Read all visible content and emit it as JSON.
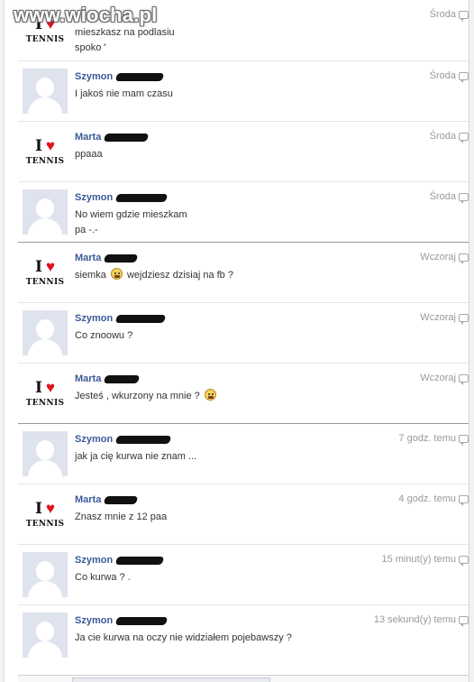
{
  "watermark": {
    "text": "www.wiocha.pl"
  },
  "messages": [
    {
      "author": "",
      "avatar": "tennis",
      "text": "mieszkasz na podlasiu\nspoko '",
      "time": "Środa",
      "scribble_width": 0
    },
    {
      "author": "Szymon",
      "avatar": "default",
      "text": "I jakoś nie mam czasu",
      "time": "Środa",
      "scribble_width": 52
    },
    {
      "author": "Marta",
      "avatar": "tennis",
      "text": "ppaaa",
      "time": "Środa",
      "scribble_width": 48
    },
    {
      "author": "Szymon",
      "avatar": "default",
      "text": "No wiem gdzie mieszkam\npa -.-",
      "time": "Środa",
      "scribble_width": 56
    },
    {
      "author": "Marta",
      "avatar": "tennis",
      "text_before": "siemka",
      "text_after": "wejdziesz dzisiaj na fb ?",
      "emoticon": "grin",
      "time": "Wczoraj",
      "scribble_width": 36
    },
    {
      "author": "Szymon",
      "avatar": "default",
      "text": "Co znoowu ?",
      "time": "Wczoraj",
      "scribble_width": 54
    },
    {
      "author": "Marta",
      "avatar": "tennis",
      "text_before": "Jesteś , wkurzony na mnie ?",
      "text_after": "",
      "emoticon": "grin",
      "time": "Wczoraj",
      "scribble_width": 38
    },
    {
      "author": "Szymon",
      "avatar": "default",
      "text": "jak ja cię kurwa nie znam ...",
      "time": "7 godz. temu",
      "scribble_width": 60
    },
    {
      "author": "Marta",
      "avatar": "tennis",
      "text": "Znasz mnie z 12 paa",
      "time": "4 godz. temu",
      "scribble_width": 36
    },
    {
      "author": "Szymon",
      "avatar": "default",
      "text": "Co kurwa ? .",
      "time": "15 minut(y) temu",
      "scribble_width": 52
    },
    {
      "author": "Szymon",
      "avatar": "default",
      "text": "Ja cie kurwa na oczy nie widziałem pojebawszy ?",
      "time": "13 sekund(y) temu",
      "scribble_width": 56
    }
  ],
  "icons": {
    "avatar_default": "silhouette-icon",
    "comment": "comment-bubble-icon",
    "emoticon": "grin-emoticon-icon",
    "heart": "heart-icon"
  },
  "colors": {
    "author": "#3b5998",
    "timestamp": "#999999",
    "heart": "#e0121d",
    "avatar_bg": "#dfe3ee"
  },
  "avatar_tennis": {
    "i_letter": "I",
    "heart": "♥",
    "word": "TENNIS"
  }
}
